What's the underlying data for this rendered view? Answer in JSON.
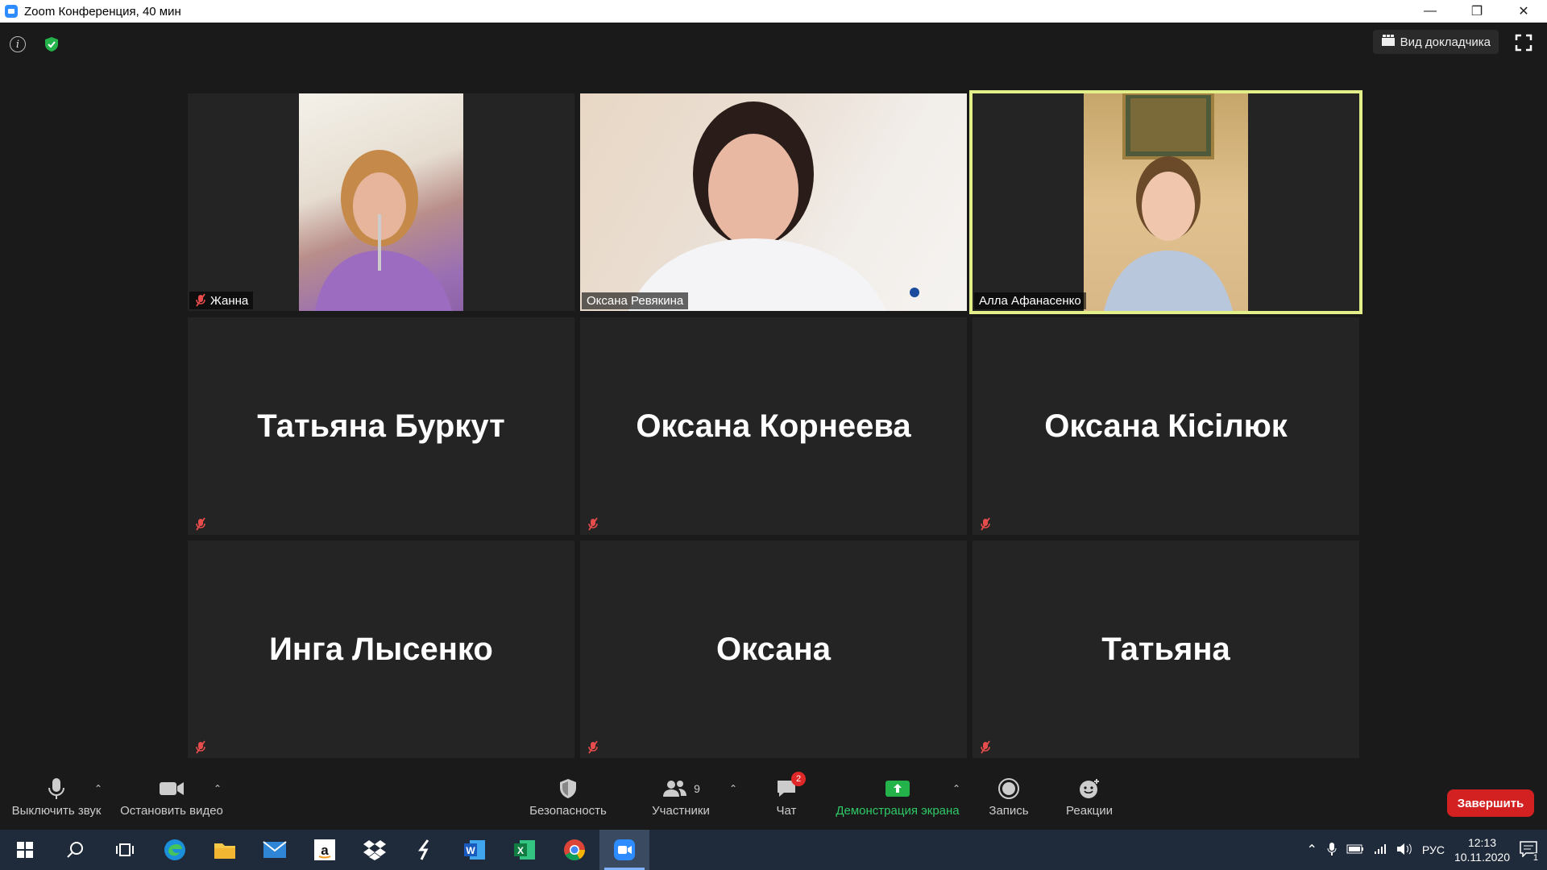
{
  "window": {
    "title": "Zoom Конференция, 40 мин"
  },
  "topbar": {
    "speaker_view_label": "Вид докладчика"
  },
  "tiles": [
    {
      "name": "Жанна",
      "has_video": true
    },
    {
      "name": "Оксана Ревякина",
      "has_video": true
    },
    {
      "name": "Алла Афанасенко",
      "has_video": true,
      "active_speaker": true
    },
    {
      "name": "Татьяна Буркут",
      "has_video": false
    },
    {
      "name": "Оксана Корнеева",
      "has_video": false
    },
    {
      "name": "Оксана Кісілюк",
      "has_video": false
    },
    {
      "name": "Инга Лысенко",
      "has_video": false
    },
    {
      "name": "Оксана",
      "has_video": false
    },
    {
      "name": "Татьяна",
      "has_video": false
    }
  ],
  "toolbar": {
    "mute_label": "Выключить звук",
    "stop_video_label": "Остановить видео",
    "security_label": "Безопасность",
    "participants_label": "Участники",
    "participants_count": "9",
    "chat_label": "Чат",
    "chat_badge": "2",
    "share_label": "Демонстрация экрана",
    "record_label": "Запись",
    "reactions_label": "Реакции",
    "end_label": "Завершить"
  },
  "taskbar": {
    "language": "РУС",
    "time": "12:13",
    "date": "10.11.2020",
    "notifications": "1"
  },
  "colors": {
    "active_border": "#e3f08a",
    "end_button": "#d32020",
    "share_green": "#2ec966",
    "zoom_blue": "#2d8cff"
  }
}
